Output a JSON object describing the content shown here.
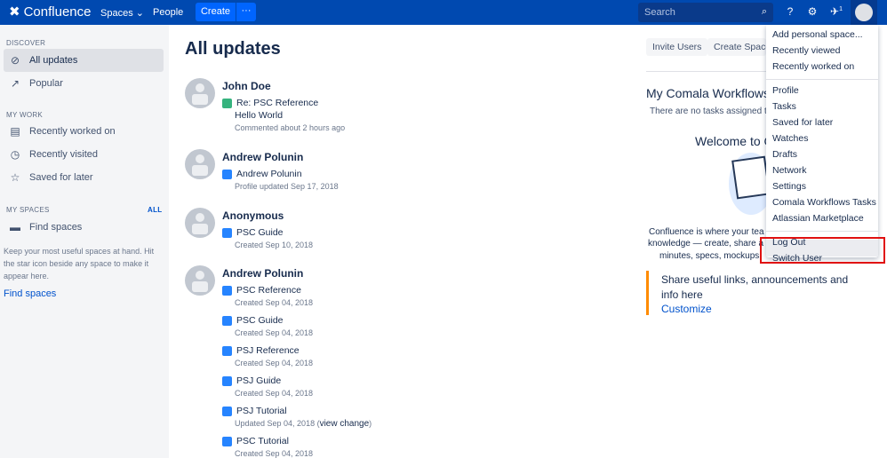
{
  "header": {
    "logo": "Confluence",
    "spaces": "Spaces ⌄",
    "people": "People",
    "create": "Create",
    "more": "···",
    "search_placeholder": "Search",
    "notif_count": "1"
  },
  "sidebar": {
    "discover": "DISCOVER",
    "discover_items": [
      {
        "label": "All updates",
        "icon": "compass-icon"
      },
      {
        "label": "Popular",
        "icon": "trending-icon"
      }
    ],
    "my_work": "MY WORK",
    "work_items": [
      {
        "label": "Recently worked on",
        "icon": "document-icon"
      },
      {
        "label": "Recently visited",
        "icon": "clock-icon"
      },
      {
        "label": "Saved for later",
        "icon": "star-icon"
      }
    ],
    "my_spaces": "MY SPACES",
    "all": "ALL",
    "find_spaces_item": "Find spaces",
    "tip": "Keep your most useful spaces at hand. Hit the star icon beside any space to make it appear here.",
    "find_spaces_link": "Find spaces"
  },
  "main": {
    "title": "All updates",
    "feed": [
      {
        "user": "John Doe",
        "items": [
          {
            "title": "Re: PSC Reference",
            "extra": "Hello World",
            "meta": "Commented about 2 hours ago",
            "type": "comment"
          }
        ]
      },
      {
        "user": "Andrew Polunin",
        "items": [
          {
            "title": "Andrew Polunin",
            "meta": "Profile updated Sep 17, 2018",
            "type": "profile"
          }
        ]
      },
      {
        "user": "Anonymous",
        "items": [
          {
            "title": "PSC Guide",
            "meta": "Created Sep 10, 2018",
            "type": "page"
          }
        ]
      },
      {
        "user": "Andrew Polunin",
        "items": [
          {
            "title": "PSC Reference",
            "meta": "Created Sep 04, 2018",
            "type": "page"
          },
          {
            "title": "PSC Guide",
            "meta": "Created Sep 04, 2018",
            "type": "page"
          },
          {
            "title": "PSJ Reference",
            "meta": "Created Sep 04, 2018",
            "type": "page"
          },
          {
            "title": "PSJ Guide",
            "meta": "Created Sep 04, 2018",
            "type": "page"
          },
          {
            "title": "PSJ Tutorial",
            "meta": "Updated Sep 04, 2018 (",
            "link": "view change",
            "meta_end": ")",
            "type": "page"
          },
          {
            "title": "PSC Tutorial",
            "meta": "Created Sep 04, 2018",
            "type": "page"
          }
        ]
      }
    ]
  },
  "right": {
    "invite": "Invite Users",
    "create_space": "Create Space",
    "comala_title": "My Comala Workflows",
    "no_tasks": "There are no tasks assigned t",
    "welcome": "Welcome to C",
    "desc1": "Confluence is where your tea",
    "desc2": "knowledge — create, share a",
    "desc3": "minutes, specs, mockups,",
    "share": "Share useful links, announcements and info here",
    "customize": "Customize"
  },
  "menu": {
    "groups": [
      [
        "Add personal space...",
        "Recently viewed",
        "Recently worked on"
      ],
      [
        "Profile",
        "Tasks",
        "Saved for later",
        "Watches",
        "Drafts",
        "Network",
        "Settings",
        "Comala Workflows Tasks",
        "Atlassian Marketplace"
      ],
      [
        "Log Out",
        "Switch User"
      ]
    ]
  },
  "colors": {
    "header": "#0049b0",
    "accent": "#0065ff",
    "highlight": "#e01010"
  }
}
